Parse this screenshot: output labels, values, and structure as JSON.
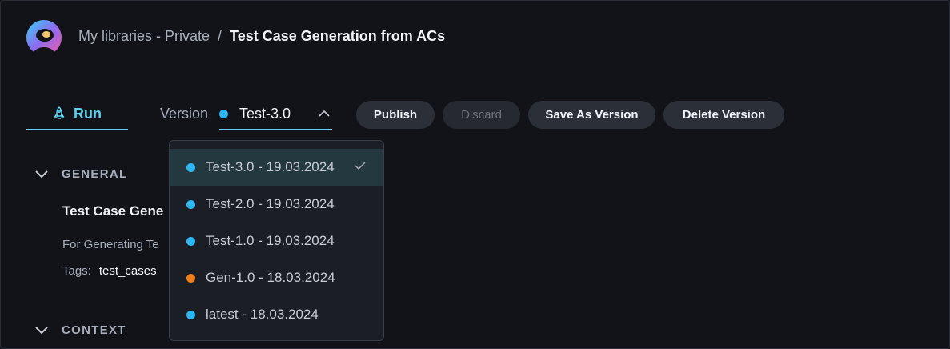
{
  "breadcrumb": {
    "library": "My libraries - Private",
    "separator": "/",
    "current": "Test Case Generation from ACs"
  },
  "toolbar": {
    "run_label": "Run",
    "version_label": "Version",
    "version_value": "Test-3.0",
    "publish_label": "Publish",
    "discard_label": "Discard",
    "save_as_version_label": "Save As Version",
    "delete_version_label": "Delete Version"
  },
  "general": {
    "heading": "GENERAL",
    "title": "Test Case Gene",
    "description": "For Generating Te",
    "tags_label": "Tags:",
    "tag": "test_cases"
  },
  "context": {
    "heading": "CONTEXT"
  },
  "versions": [
    {
      "label": "Test-3.0 - 19.03.2024",
      "status_color": "#2cb6f3",
      "selected": true
    },
    {
      "label": "Test-2.0 - 19.03.2024",
      "status_color": "#2cb6f3",
      "selected": false
    },
    {
      "label": "Test-1.0 - 19.03.2024",
      "status_color": "#2cb6f3",
      "selected": false
    },
    {
      "label": "Gen-1.0 - 18.03.2024",
      "status_color": "#f07e1b",
      "selected": false
    },
    {
      "label": "latest - 18.03.2024",
      "status_color": "#2cb6f3",
      "selected": false
    }
  ],
  "colors": {
    "accent": "#5ed2f0",
    "background": "#111318"
  },
  "icons": {
    "logo": "app-logo",
    "run": "rocket-icon",
    "chevron": "chevron-up-icon",
    "check": "check-icon",
    "section": "chevron-down-icon"
  }
}
